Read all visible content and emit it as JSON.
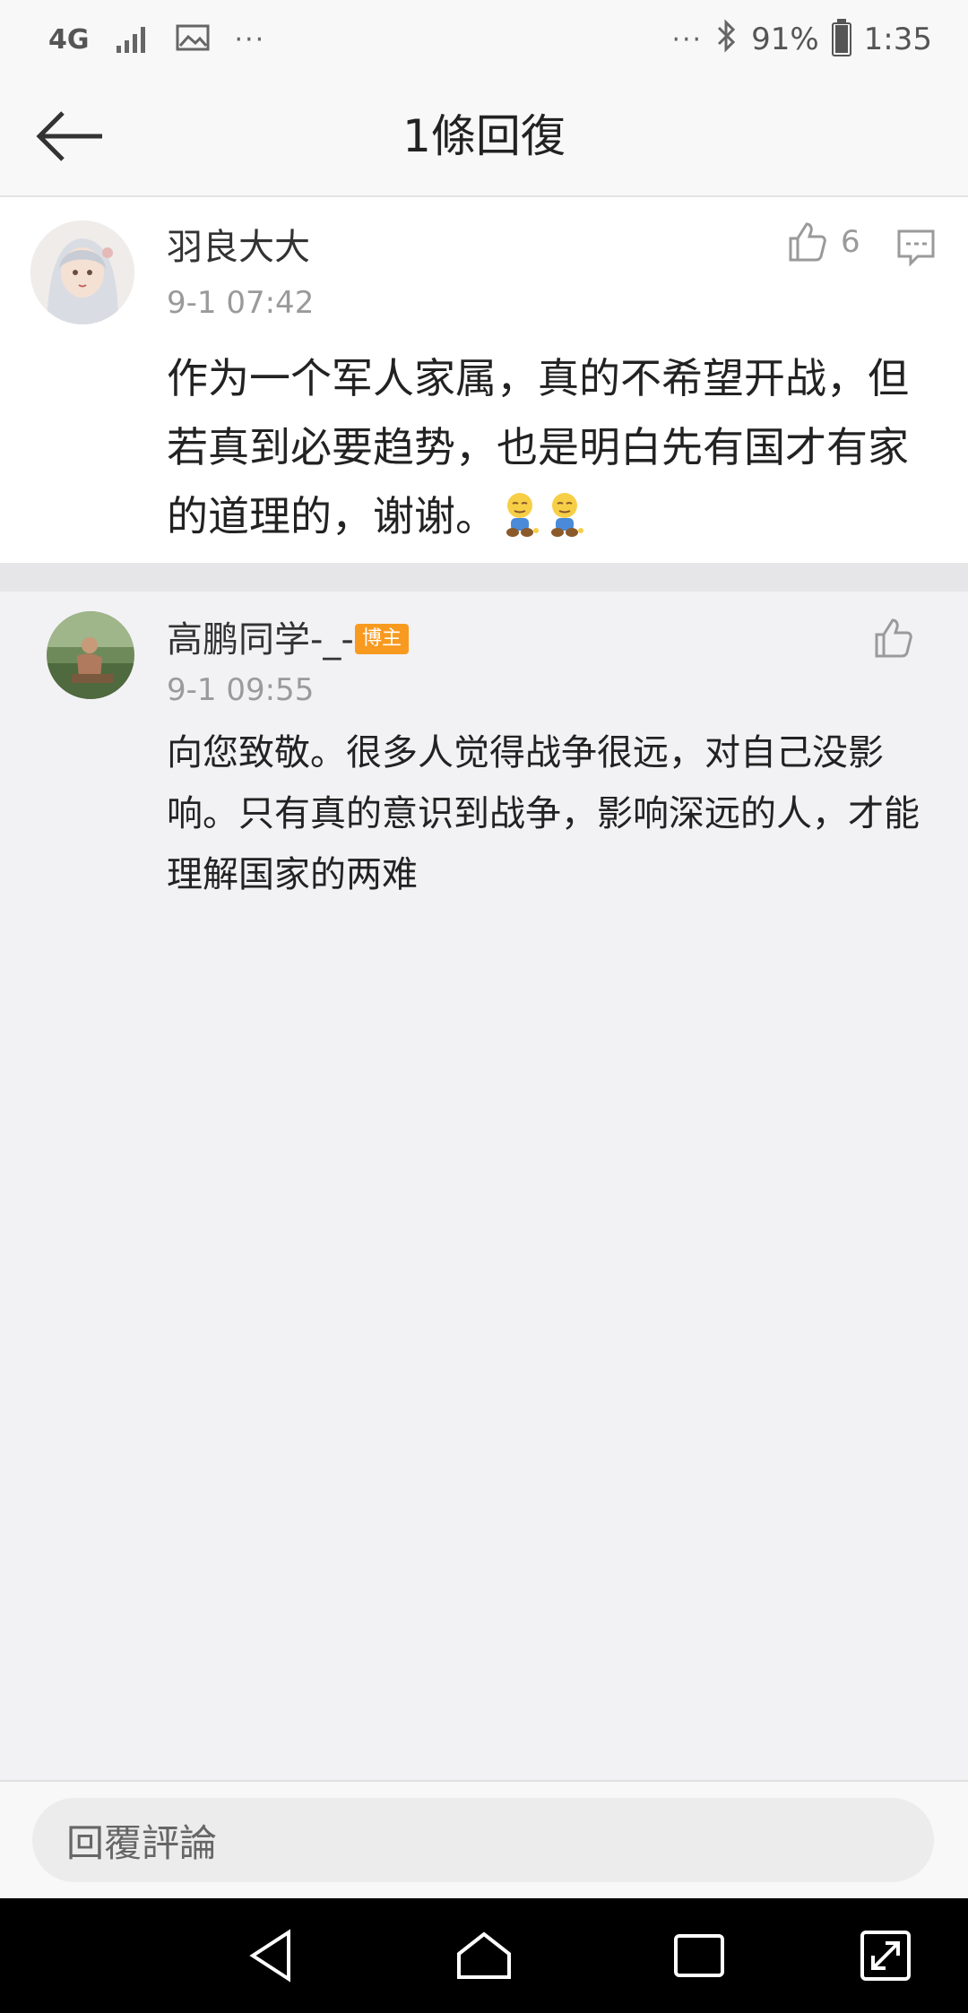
{
  "status_bar": {
    "network": "4G",
    "more_left": "···",
    "more_right": "···",
    "battery_percent": "91%",
    "battery_level": 0.91,
    "time": "1:35"
  },
  "header": {
    "title": "1條回復"
  },
  "main_comment": {
    "username": "羽良大大",
    "timestamp": "9-1 07:42",
    "like_count": "6",
    "text": "作为一个军人家属，真的不希望开战，但若真到必要趋势，也是明白先有国才有家的道理的，谢谢。"
  },
  "reply": {
    "username": "高鹏同学-_-",
    "badge": "博主",
    "timestamp": "9-1 09:55",
    "text": "向您致敬。很多人觉得战争很远，对自己没影响。只有真的意识到战争，影响深远的人，才能理解国家的两难"
  },
  "reply_bar": {
    "placeholder": "回覆評論"
  },
  "colors": {
    "background": "#f2f2f5",
    "badge": "#f89a1f",
    "muted": "#9a9a9a"
  },
  "icons": [
    "back-arrow-icon",
    "thumbs-up-icon",
    "comment-icon",
    "bluetooth-icon",
    "image-icon",
    "signal-icon",
    "battery-icon",
    "nav-back-icon",
    "nav-home-icon",
    "nav-recents-icon",
    "nav-expand-icon"
  ]
}
